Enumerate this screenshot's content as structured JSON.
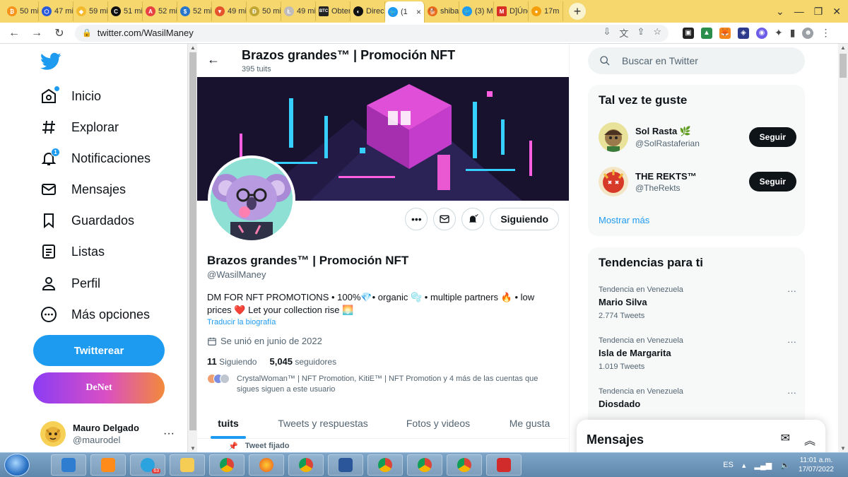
{
  "browser": {
    "tabs": [
      {
        "label": "50 mi",
        "color": "#f7931a"
      },
      {
        "label": "47 mi",
        "color": "#2a5ada"
      },
      {
        "label": "59 mi",
        "color": "#f3ba2f"
      },
      {
        "label": "51 mi",
        "color": "#111111"
      },
      {
        "label": "52 mi",
        "color": "#e84142"
      },
      {
        "label": "52 mi",
        "color": "#2775ca"
      },
      {
        "label": "49 mi",
        "color": "#e5532d"
      },
      {
        "label": "50 mi",
        "color": "#c2a633"
      },
      {
        "label": "49 mi",
        "color": "#bfbbbb"
      },
      {
        "label": "Obter",
        "color": "#222222",
        "badge": "BTC"
      },
      {
        "label": "Direc",
        "color": "#111111"
      },
      {
        "label": "(1",
        "color": "#1d9bf0",
        "active": true
      },
      {
        "label": "shiba",
        "color": "#e86a1a"
      },
      {
        "label": "(3) M",
        "color": "#1d9bf0"
      },
      {
        "label": "D]Úne",
        "color": "#d93025",
        "badge": "M"
      },
      {
        "label": "17m",
        "color": "#f59e0b"
      }
    ],
    "active_tab_close": "×",
    "new_tab": "+",
    "url": "twitter.com/WasilManey"
  },
  "nav": {
    "items": [
      {
        "label": "Inicio",
        "icon": "home-icon"
      },
      {
        "label": "Explorar",
        "icon": "hashtag-icon"
      },
      {
        "label": "Notificaciones",
        "icon": "bell-icon",
        "badge": "1"
      },
      {
        "label": "Mensajes",
        "icon": "envelope-icon"
      },
      {
        "label": "Guardados",
        "icon": "bookmark-icon"
      },
      {
        "label": "Listas",
        "icon": "list-icon"
      },
      {
        "label": "Perfil",
        "icon": "person-icon"
      },
      {
        "label": "Más opciones",
        "icon": "more-circle-icon"
      }
    ],
    "tweet_button": "Twitterear",
    "denet_button": "DeNet",
    "user_name": "Mauro Delgado",
    "user_handle": "@maurodel",
    "user_more": "···"
  },
  "profile": {
    "header_title": "Brazos grandes™ | Promoción NFT",
    "tweet_count": "395 tuits",
    "name": "Brazos grandes™ | Promoción NFT",
    "handle": "@WasilManey",
    "bio_line1": "DM FOR NFT PROMOTIONS • 100%💎• organic 🫧 • multiple partners 🔥 • low",
    "bio_line2": "prices ❤️ Let your collection rise 🌅",
    "translate": "Traducir la biografía",
    "joined": "Se unió en junio de 2022",
    "following_count": "11",
    "following_label": "Siguiendo",
    "followers_count": "5,045",
    "followers_label": "seguidores",
    "followed_by": "CrystalWoman™ | NFT Promotion, KitiE™ | NFT Promotion y 4 más de las cuentas que sigues siguen a este usuario",
    "follow_button": "Siguiendo",
    "tabs": [
      "tuits",
      "Tweets y respuestas",
      "Fotos y videos",
      "Me gusta"
    ],
    "pinned": "Tweet fijado"
  },
  "sidebar": {
    "search_placeholder": "Buscar en Twitter",
    "suggest_title": "Tal vez te guste",
    "suggestions": [
      {
        "name": "Sol Rasta 🌿",
        "handle": "@SolRastaferian",
        "button": "Seguir"
      },
      {
        "name": "THE REKTS™",
        "handle": "@TheRekts",
        "button": "Seguir"
      }
    ],
    "show_more": "Mostrar más",
    "trends_title": "Tendencias para ti",
    "trends": [
      {
        "context": "Tendencia en Venezuela",
        "name": "Mario Silva",
        "count": "2.774 Tweets"
      },
      {
        "context": "Tendencia en Venezuela",
        "name": "Isla de Margarita",
        "count": "1.019 Tweets"
      },
      {
        "context": "Tendencia en Venezuela",
        "name": "Diosdado",
        "count": ""
      }
    ],
    "trend_more": "···"
  },
  "messages": {
    "title": "Mensajes"
  },
  "taskbar": {
    "lang": "ES",
    "time": "11:01 a.m.",
    "date": "17/07/2022",
    "telegram_badge": "63"
  },
  "colors": {
    "accent": "#1d9bf0",
    "text": "#0f1419",
    "muted": "#536471"
  }
}
